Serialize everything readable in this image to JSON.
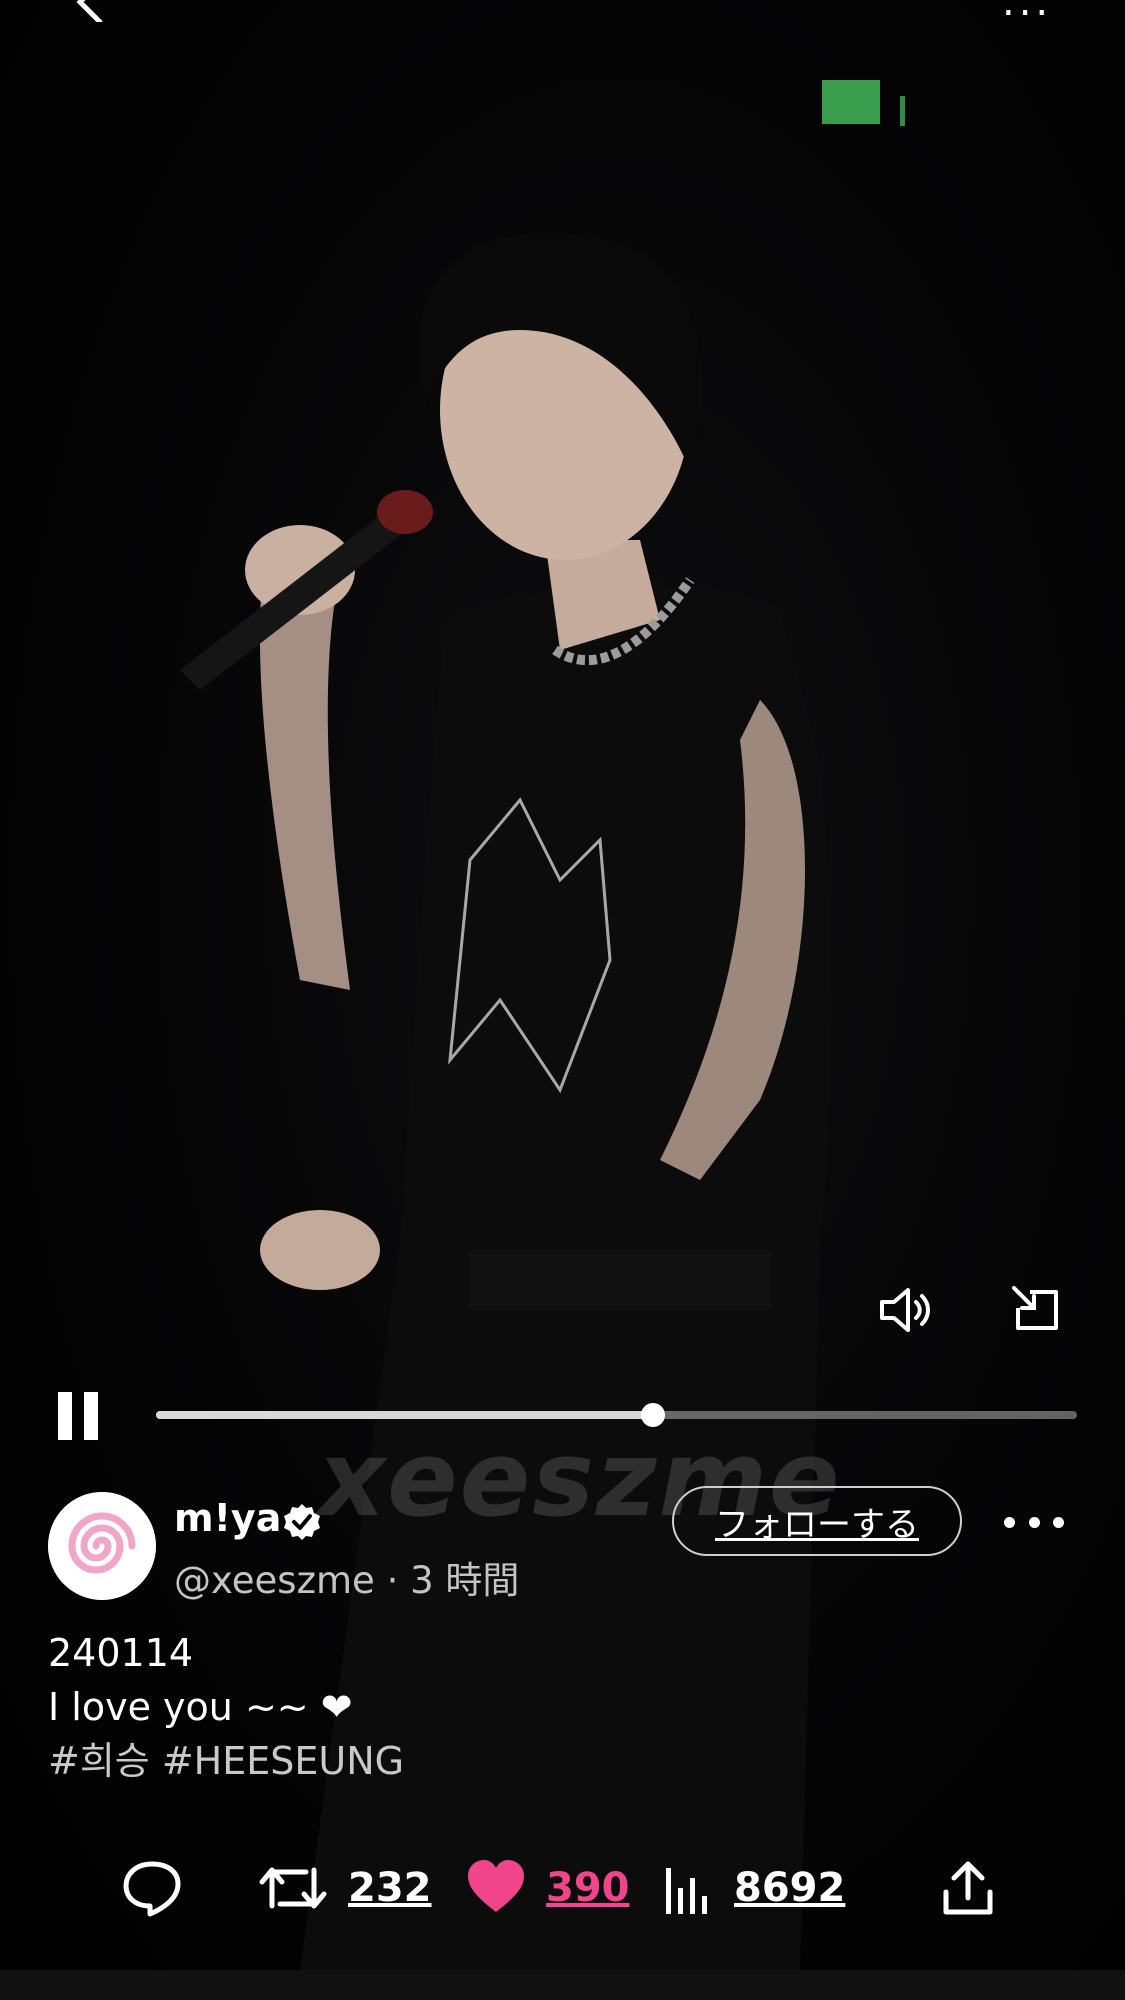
{
  "top_bar": {
    "back_icon": "back-arrow-icon",
    "more_icon": "more-horizontal-icon",
    "more_label": "..."
  },
  "player": {
    "playback_progress": 0.54,
    "volume_icon": "speaker-on-icon",
    "pip_icon": "picture-in-picture-icon",
    "pause_icon": "pause-icon"
  },
  "watermark": "xeeszme",
  "author": {
    "display_name": "m!ya",
    "verified": true,
    "handle": "@xeeszme",
    "separator": "·",
    "time_ago": "3 時間",
    "follow_label": "フォローする"
  },
  "tweet": {
    "line1": "240114",
    "line2": "I love you ~~ ❤",
    "hashtags": "#희승 #HEESEUNG"
  },
  "actions": {
    "reply_count": "",
    "retweet_count": "232",
    "like_count": "390",
    "view_count": "8692",
    "like_color": "#f0458b"
  }
}
